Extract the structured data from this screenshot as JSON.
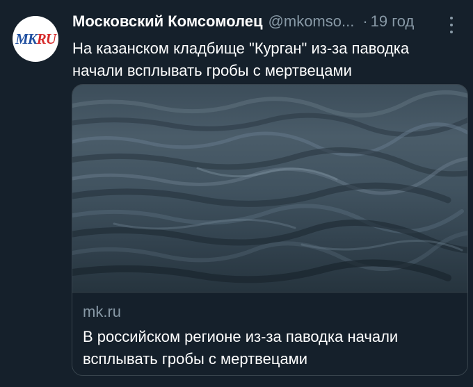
{
  "tweet": {
    "author_name": "Московский Комсомолец",
    "author_handle": "@mkomso...",
    "separator": "·",
    "timestamp": "19 год",
    "avatar_logo_main": "MK",
    "avatar_logo_accent": "RU",
    "text": "На казанском кладбище \"Курган\" из-за паводка начали всплывать гробы с мертвецами"
  },
  "link_card": {
    "image_subject": "water-waves",
    "domain": "mk.ru",
    "title": "В российском регионе из-за паводка начали всплывать гробы с мертвецами"
  },
  "colors": {
    "background": "#15202b",
    "secondary_text": "#8899a6",
    "border": "#38444d",
    "logo_blue": "#1f4fa0",
    "logo_red": "#d62b2b"
  }
}
